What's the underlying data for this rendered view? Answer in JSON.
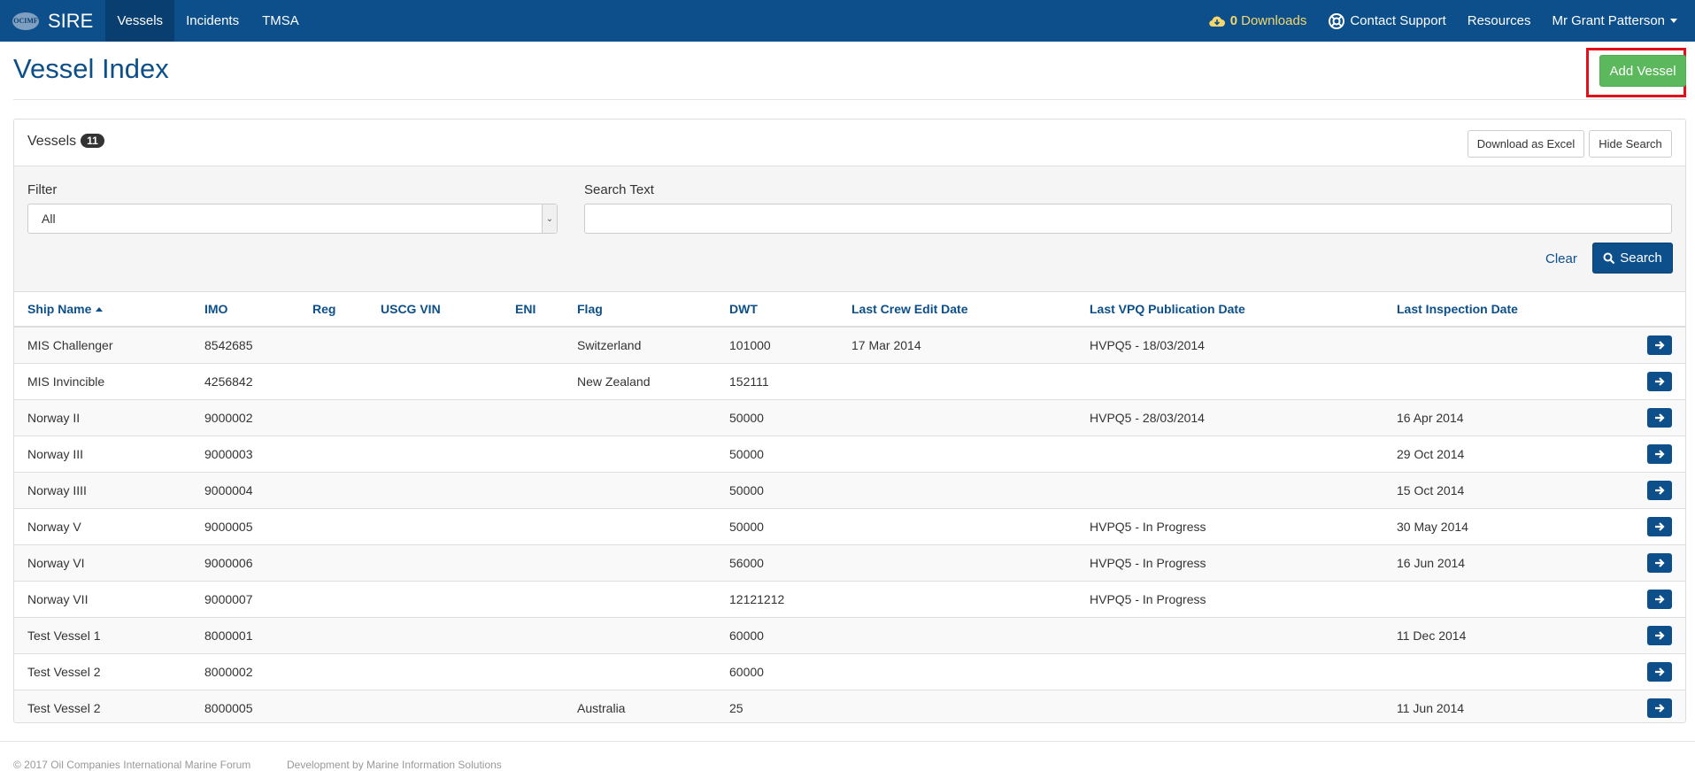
{
  "nav": {
    "logo_text": "OCIMF",
    "brand": "SIRE",
    "items": [
      {
        "label": "Vessels",
        "active": true
      },
      {
        "label": "Incidents",
        "active": false
      },
      {
        "label": "TMSA",
        "active": false
      }
    ],
    "downloads_count": "0",
    "downloads_label": "Downloads",
    "contact_label": "Contact Support",
    "resources_label": "Resources",
    "user_label": "Mr Grant Patterson"
  },
  "header": {
    "title": "Vessel Index",
    "add_button": "Add Vessel"
  },
  "panel": {
    "title": "Vessels",
    "count": "11",
    "download_excel": "Download as Excel",
    "hide_search": "Hide Search"
  },
  "search": {
    "filter_label": "Filter",
    "filter_value": "All",
    "search_text_label": "Search Text",
    "search_text_value": "",
    "clear_label": "Clear",
    "search_button": "Search"
  },
  "table": {
    "columns": [
      "Ship Name",
      "IMO",
      "Reg",
      "USCG VIN",
      "ENI",
      "Flag",
      "DWT",
      "Last Crew Edit Date",
      "Last VPQ Publication Date",
      "Last Inspection Date"
    ],
    "rows": [
      [
        "MIS Challenger",
        "8542685",
        "",
        "",
        "",
        "Switzerland",
        "101000",
        "17 Mar 2014",
        "HVPQ5 - 18/03/2014",
        ""
      ],
      [
        "MIS Invincible",
        "4256842",
        "",
        "",
        "",
        "New Zealand",
        "152111",
        "",
        "",
        ""
      ],
      [
        "Norway II",
        "9000002",
        "",
        "",
        "",
        "",
        "50000",
        "",
        "HVPQ5 - 28/03/2014",
        "16 Apr 2014"
      ],
      [
        "Norway III",
        "9000003",
        "",
        "",
        "",
        "",
        "50000",
        "",
        "",
        "29 Oct 2014"
      ],
      [
        "Norway IIII",
        "9000004",
        "",
        "",
        "",
        "",
        "50000",
        "",
        "",
        "15 Oct 2014"
      ],
      [
        "Norway V",
        "9000005",
        "",
        "",
        "",
        "",
        "50000",
        "",
        "HVPQ5 - In Progress",
        "30 May 2014"
      ],
      [
        "Norway VI",
        "9000006",
        "",
        "",
        "",
        "",
        "56000",
        "",
        "HVPQ5 - In Progress",
        "16 Jun 2014"
      ],
      [
        "Norway VII",
        "9000007",
        "",
        "",
        "",
        "",
        "12121212",
        "",
        "HVPQ5 - In Progress",
        ""
      ],
      [
        "Test Vessel 1",
        "8000001",
        "",
        "",
        "",
        "",
        "60000",
        "",
        "",
        "11 Dec 2014"
      ],
      [
        "Test Vessel 2",
        "8000002",
        "",
        "",
        "",
        "",
        "60000",
        "",
        "",
        ""
      ],
      [
        "Test Vessel 2",
        "8000005",
        "",
        "",
        "",
        "Australia",
        "25",
        "",
        "",
        "11 Jun 2014"
      ]
    ]
  },
  "footer": {
    "copyright": "© 2017 Oil Companies International Marine Forum",
    "development": "Development by Marine Information Solutions"
  },
  "colors": {
    "primary": "#0c4f8a",
    "success": "#5cb85c",
    "highlight": "#e3101a"
  }
}
